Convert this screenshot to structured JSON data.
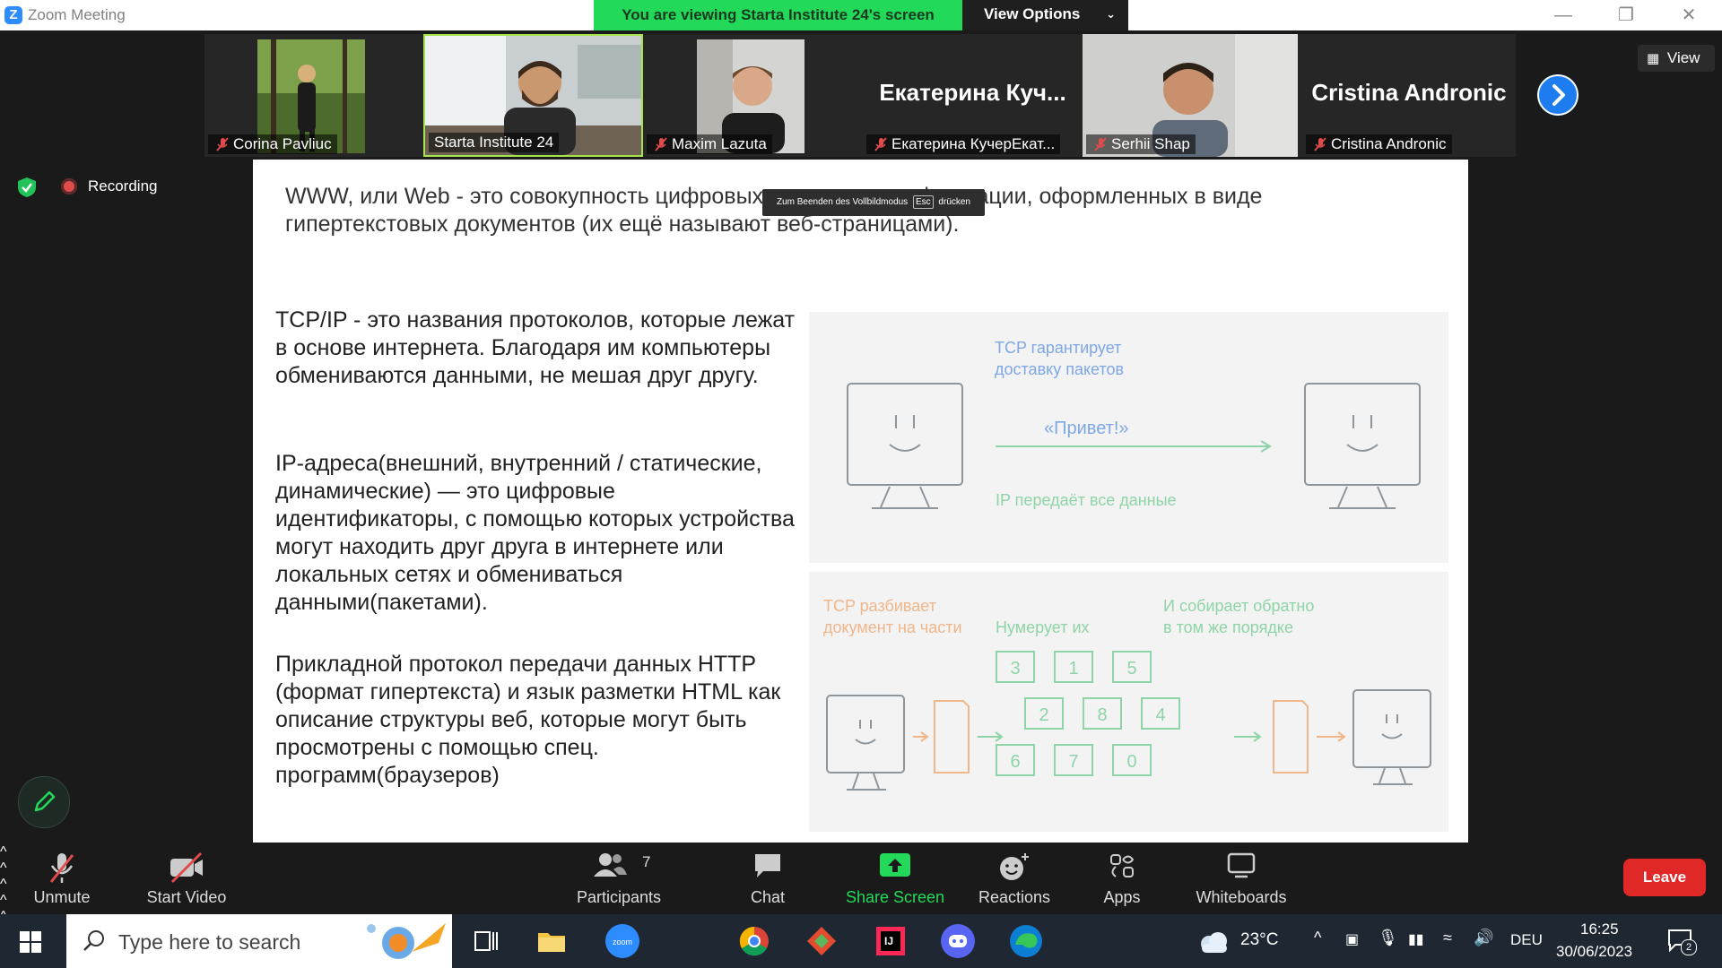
{
  "window": {
    "title": "Zoom Meeting",
    "share_banner": "You are viewing Starta Institute 24's screen",
    "view_options": "View Options"
  },
  "participants_strip": {
    "tiles": [
      {
        "name": "Corina Pavliuc",
        "muted": true,
        "has_video": true
      },
      {
        "name": "Starta Institute 24",
        "muted": false,
        "has_video": true,
        "active_speaker": true
      },
      {
        "name": "Maxim Lazuta",
        "muted": true,
        "has_video": true
      },
      {
        "name": "Екатерина КучерЕкат...",
        "big_name": "Екатерина  Куч...",
        "muted": true,
        "has_video": false
      },
      {
        "name": "Serhii Shap",
        "muted": true,
        "has_video": true
      },
      {
        "name": "Cristina Andronic",
        "big_name": "Cristina Andronic",
        "muted": true,
        "has_video": false
      }
    ],
    "view_button": "View"
  },
  "recording": {
    "label": "Recording"
  },
  "slide": {
    "www_text": "WWW, или Web - это совокупность цифровых источников информации, оформленных в виде гипертекстовых документов (их ещё называют веб-страницами).",
    "esc_tip": {
      "before": "Zum Beenden des Vollbildmodus",
      "key": "Esc",
      "after": "drücken"
    },
    "tcp_text": "TCP/IP - это названия протоколов, которые лежат в основе интернета. Благодаря им компьютеры обмениваются данными, не мешая друг другу.",
    "ip_text": "IP-адреса(внешний, внутренний / статические, динамические) — это цифровые идентификаторы, с помощью которых устройства могут находить друг друга в интернете или локальных сетях и обмениваться данными(пакетами).",
    "http_text": "Прикладной протокол передачи данных HTTP (формат гипертекста) и язык разметки HTML как описание структуры веб, которые могут быть просмотрены с помощью спец. программ(браузеров)",
    "diagram_top": {
      "tcp_label": "TCP гарантирует\nдоставку пакетов",
      "message": "«Привет!»",
      "ip_label": "IP передаёт все данные"
    },
    "diagram_bottom": {
      "split_label": "TCP разбивает\nдокумент на части",
      "number_label": "Нумерует их",
      "assemble_label": "И собирает обратно\nв том же порядке",
      "packets": [
        "3",
        "1",
        "5",
        "2",
        "8",
        "4",
        "6",
        "7",
        "0"
      ]
    }
  },
  "toolbar": {
    "unmute": "Unmute",
    "start_video": "Start Video",
    "participants": "Participants",
    "participants_count": "7",
    "chat": "Chat",
    "share_screen": "Share Screen",
    "reactions": "Reactions",
    "apps": "Apps",
    "whiteboards": "Whiteboards",
    "leave": "Leave"
  },
  "taskbar": {
    "search_placeholder": "Type here to search",
    "weather": "23°C",
    "language": "DEU",
    "time": "16:25",
    "date": "30/06/2023",
    "notifications": "2"
  },
  "colors": {
    "accent_green": "#23d959",
    "zoom_blue": "#2d8cff",
    "leave_red": "#e02828",
    "diagram_green": "#8ed4a7",
    "diagram_orange": "#f0b68b"
  }
}
